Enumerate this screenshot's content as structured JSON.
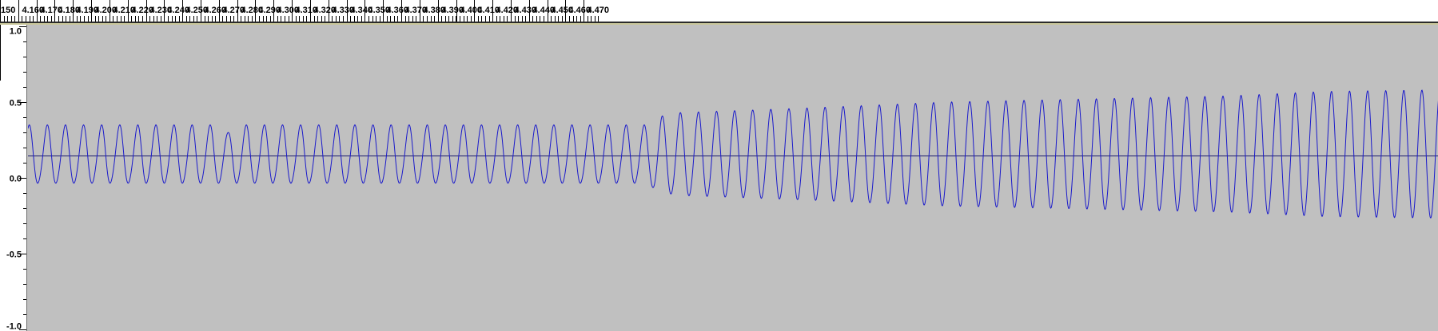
{
  "timeline": {
    "ticks": [
      {
        "label": "150",
        "value": 4.15
      },
      {
        "label": "4.160",
        "value": 4.16
      },
      {
        "label": "4.170",
        "value": 4.17
      },
      {
        "label": "4.180",
        "value": 4.18
      },
      {
        "label": "4.190",
        "value": 4.19
      },
      {
        "label": "4.200",
        "value": 4.2
      },
      {
        "label": "4.210",
        "value": 4.21
      },
      {
        "label": "4.220",
        "value": 4.22
      },
      {
        "label": "4.230",
        "value": 4.23
      },
      {
        "label": "4.240",
        "value": 4.24
      },
      {
        "label": "4.250",
        "value": 4.25
      },
      {
        "label": "4.260",
        "value": 4.26
      },
      {
        "label": "4.270",
        "value": 4.27
      },
      {
        "label": "4.280",
        "value": 4.28
      },
      {
        "label": "4.290",
        "value": 4.29
      },
      {
        "label": "4.300",
        "value": 4.3
      },
      {
        "label": "4.310",
        "value": 4.31
      },
      {
        "label": "4.320",
        "value": 4.32
      },
      {
        "label": "4.330",
        "value": 4.33
      },
      {
        "label": "4.340",
        "value": 4.34
      },
      {
        "label": "4.350",
        "value": 4.35
      },
      {
        "label": "4.360",
        "value": 4.36
      },
      {
        "label": "4.370",
        "value": 4.37
      },
      {
        "label": "4.380",
        "value": 4.38
      },
      {
        "label": "4.390",
        "value": 4.39
      },
      {
        "label": "4.400",
        "value": 4.4
      },
      {
        "label": "4.410",
        "value": 4.41
      },
      {
        "label": "4.420",
        "value": 4.42
      },
      {
        "label": "4.430",
        "value": 4.43
      },
      {
        "label": "4.440",
        "value": 4.44
      },
      {
        "label": "4.450",
        "value": 4.45
      },
      {
        "label": "4.460",
        "value": 4.46
      },
      {
        "label": "4.470",
        "value": 4.47
      }
    ]
  },
  "amplitude_ruler": {
    "ticks": [
      {
        "label": "1.0",
        "value": 1.0
      },
      {
        "label": "0.5",
        "value": 0.5
      },
      {
        "label": "0.0",
        "value": 0.0
      },
      {
        "label": "-0.5",
        "value": -0.5
      },
      {
        "label": "-1.0",
        "value": -1.0
      }
    ]
  },
  "waveform": {
    "color": "#1a1acb",
    "zero_line_color": "#1a1a6e",
    "background": "#c0c0c0",
    "cycles": 78,
    "amplitude_profile": [
      [
        0.0,
        0.19
      ],
      [
        0.44,
        0.19
      ],
      [
        0.445,
        0.24
      ],
      [
        0.46,
        0.27
      ],
      [
        0.55,
        0.3
      ],
      [
        0.65,
        0.34
      ],
      [
        0.75,
        0.36
      ],
      [
        0.85,
        0.38
      ],
      [
        0.92,
        0.41
      ],
      [
        1.0,
        0.42
      ]
    ]
  },
  "colors": {
    "ruler_background": "#ffffff",
    "ruler_text": "#000000",
    "separator_dark": "#2b2b2b",
    "separator_light": "#c9c79a"
  }
}
